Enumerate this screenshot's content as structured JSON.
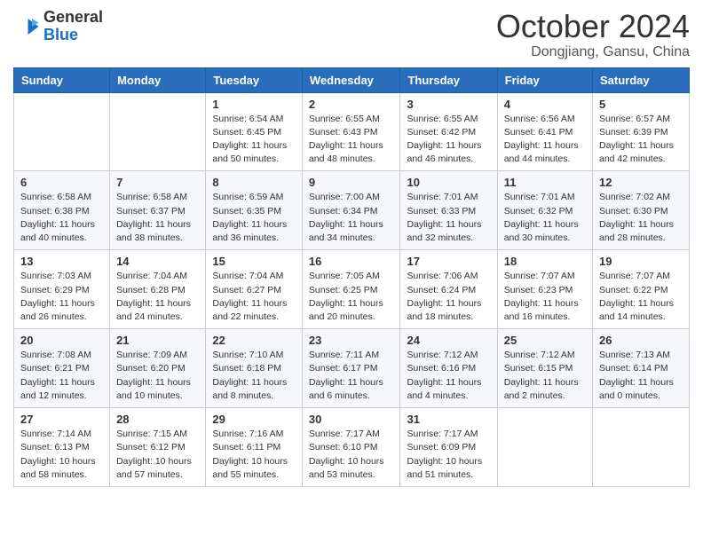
{
  "logo": {
    "general": "General",
    "blue": "Blue"
  },
  "title": "October 2024",
  "location": "Dongjiang, Gansu, China",
  "weekdays": [
    "Sunday",
    "Monday",
    "Tuesday",
    "Wednesday",
    "Thursday",
    "Friday",
    "Saturday"
  ],
  "weeks": [
    [
      {
        "day": "",
        "info": ""
      },
      {
        "day": "",
        "info": ""
      },
      {
        "day": "1",
        "info": "Sunrise: 6:54 AM\nSunset: 6:45 PM\nDaylight: 11 hours and 50 minutes."
      },
      {
        "day": "2",
        "info": "Sunrise: 6:55 AM\nSunset: 6:43 PM\nDaylight: 11 hours and 48 minutes."
      },
      {
        "day": "3",
        "info": "Sunrise: 6:55 AM\nSunset: 6:42 PM\nDaylight: 11 hours and 46 minutes."
      },
      {
        "day": "4",
        "info": "Sunrise: 6:56 AM\nSunset: 6:41 PM\nDaylight: 11 hours and 44 minutes."
      },
      {
        "day": "5",
        "info": "Sunrise: 6:57 AM\nSunset: 6:39 PM\nDaylight: 11 hours and 42 minutes."
      }
    ],
    [
      {
        "day": "6",
        "info": "Sunrise: 6:58 AM\nSunset: 6:38 PM\nDaylight: 11 hours and 40 minutes."
      },
      {
        "day": "7",
        "info": "Sunrise: 6:58 AM\nSunset: 6:37 PM\nDaylight: 11 hours and 38 minutes."
      },
      {
        "day": "8",
        "info": "Sunrise: 6:59 AM\nSunset: 6:35 PM\nDaylight: 11 hours and 36 minutes."
      },
      {
        "day": "9",
        "info": "Sunrise: 7:00 AM\nSunset: 6:34 PM\nDaylight: 11 hours and 34 minutes."
      },
      {
        "day": "10",
        "info": "Sunrise: 7:01 AM\nSunset: 6:33 PM\nDaylight: 11 hours and 32 minutes."
      },
      {
        "day": "11",
        "info": "Sunrise: 7:01 AM\nSunset: 6:32 PM\nDaylight: 11 hours and 30 minutes."
      },
      {
        "day": "12",
        "info": "Sunrise: 7:02 AM\nSunset: 6:30 PM\nDaylight: 11 hours and 28 minutes."
      }
    ],
    [
      {
        "day": "13",
        "info": "Sunrise: 7:03 AM\nSunset: 6:29 PM\nDaylight: 11 hours and 26 minutes."
      },
      {
        "day": "14",
        "info": "Sunrise: 7:04 AM\nSunset: 6:28 PM\nDaylight: 11 hours and 24 minutes."
      },
      {
        "day": "15",
        "info": "Sunrise: 7:04 AM\nSunset: 6:27 PM\nDaylight: 11 hours and 22 minutes."
      },
      {
        "day": "16",
        "info": "Sunrise: 7:05 AM\nSunset: 6:25 PM\nDaylight: 11 hours and 20 minutes."
      },
      {
        "day": "17",
        "info": "Sunrise: 7:06 AM\nSunset: 6:24 PM\nDaylight: 11 hours and 18 minutes."
      },
      {
        "day": "18",
        "info": "Sunrise: 7:07 AM\nSunset: 6:23 PM\nDaylight: 11 hours and 16 minutes."
      },
      {
        "day": "19",
        "info": "Sunrise: 7:07 AM\nSunset: 6:22 PM\nDaylight: 11 hours and 14 minutes."
      }
    ],
    [
      {
        "day": "20",
        "info": "Sunrise: 7:08 AM\nSunset: 6:21 PM\nDaylight: 11 hours and 12 minutes."
      },
      {
        "day": "21",
        "info": "Sunrise: 7:09 AM\nSunset: 6:20 PM\nDaylight: 11 hours and 10 minutes."
      },
      {
        "day": "22",
        "info": "Sunrise: 7:10 AM\nSunset: 6:18 PM\nDaylight: 11 hours and 8 minutes."
      },
      {
        "day": "23",
        "info": "Sunrise: 7:11 AM\nSunset: 6:17 PM\nDaylight: 11 hours and 6 minutes."
      },
      {
        "day": "24",
        "info": "Sunrise: 7:12 AM\nSunset: 6:16 PM\nDaylight: 11 hours and 4 minutes."
      },
      {
        "day": "25",
        "info": "Sunrise: 7:12 AM\nSunset: 6:15 PM\nDaylight: 11 hours and 2 minutes."
      },
      {
        "day": "26",
        "info": "Sunrise: 7:13 AM\nSunset: 6:14 PM\nDaylight: 11 hours and 0 minutes."
      }
    ],
    [
      {
        "day": "27",
        "info": "Sunrise: 7:14 AM\nSunset: 6:13 PM\nDaylight: 10 hours and 58 minutes."
      },
      {
        "day": "28",
        "info": "Sunrise: 7:15 AM\nSunset: 6:12 PM\nDaylight: 10 hours and 57 minutes."
      },
      {
        "day": "29",
        "info": "Sunrise: 7:16 AM\nSunset: 6:11 PM\nDaylight: 10 hours and 55 minutes."
      },
      {
        "day": "30",
        "info": "Sunrise: 7:17 AM\nSunset: 6:10 PM\nDaylight: 10 hours and 53 minutes."
      },
      {
        "day": "31",
        "info": "Sunrise: 7:17 AM\nSunset: 6:09 PM\nDaylight: 10 hours and 51 minutes."
      },
      {
        "day": "",
        "info": ""
      },
      {
        "day": "",
        "info": ""
      }
    ]
  ]
}
